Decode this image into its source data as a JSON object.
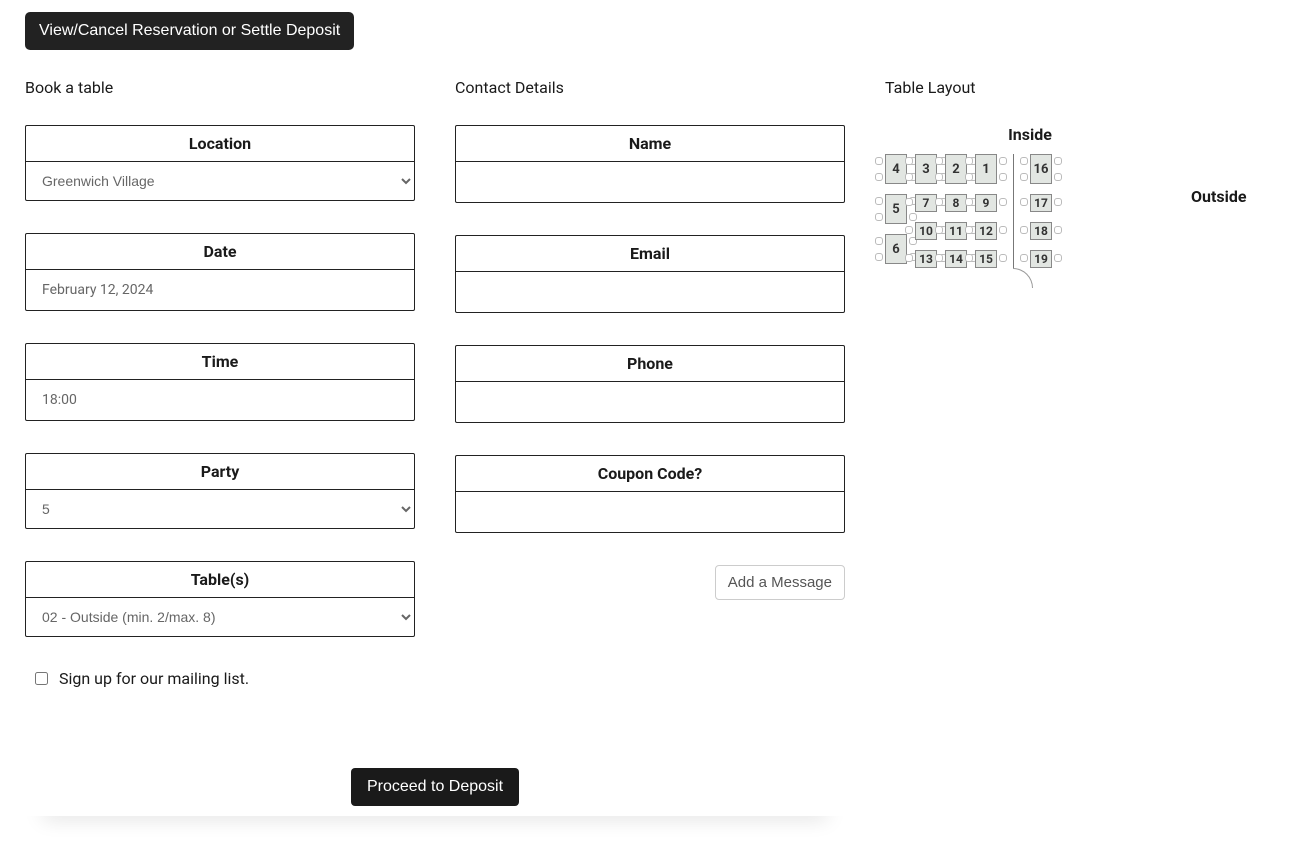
{
  "top_button": "View/Cancel Reservation or Settle Deposit",
  "sections": {
    "book": "Book a table",
    "contact": "Contact Details",
    "layout": "Table Layout"
  },
  "book": {
    "location_label": "Location",
    "location_value": "Greenwich Village",
    "date_label": "Date",
    "date_value": "February 12, 2024",
    "time_label": "Time",
    "time_value": "18:00",
    "party_label": "Party",
    "party_value": "5",
    "tables_label": "Table(s)",
    "tables_value": "02 - Outside (min. 2/max. 8)",
    "mailing_label": "Sign up for our mailing list."
  },
  "contact": {
    "name_label": "Name",
    "name_value": "",
    "email_label": "Email",
    "email_value": "",
    "phone_label": "Phone",
    "phone_value": "",
    "coupon_label": "Coupon Code?",
    "coupon_value": "",
    "add_message": "Add a Message"
  },
  "layout": {
    "inside_label": "Inside",
    "outside_label": "Outside",
    "inside_large_left": [
      "4",
      "5",
      "6"
    ],
    "inside_col2": [
      "3",
      "7",
      "10",
      "13"
    ],
    "inside_col3": [
      "2",
      "8",
      "11",
      "14"
    ],
    "inside_col4": [
      "1",
      "9",
      "12",
      "15"
    ],
    "outside_col": [
      "16",
      "17",
      "18",
      "19"
    ]
  },
  "proceed": "Proceed to Deposit"
}
